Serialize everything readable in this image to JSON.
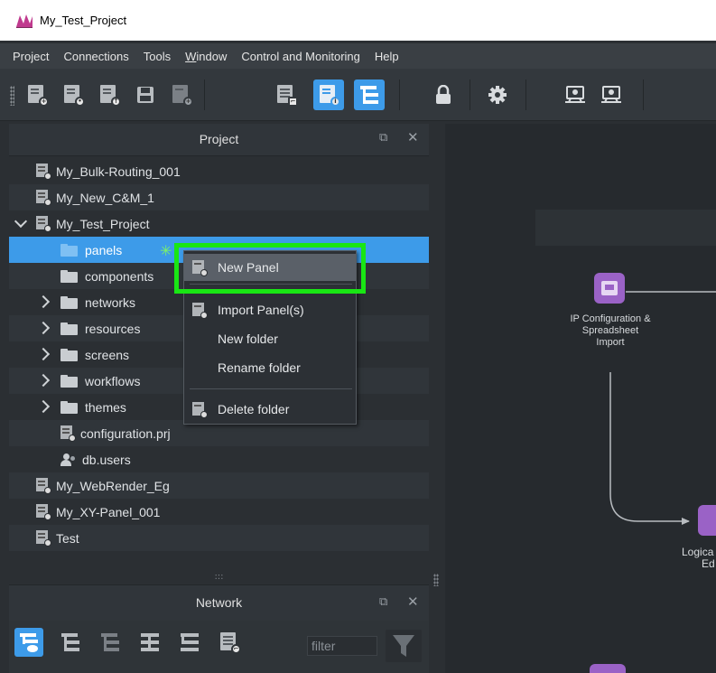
{
  "window": {
    "title": "My_Test_Project"
  },
  "menubar": [
    "Project",
    "Connections",
    "Tools",
    "Window",
    "Control and Monitoring",
    "Help"
  ],
  "toolbar": {
    "buttons": [
      "new-project-icon",
      "import-project-icon",
      "upload-project-icon",
      "save-icon",
      "save-all-icon",
      "diagnostics-icon",
      "project-info-icon",
      "network-tree-icon",
      "lock-icon",
      "settings-icon",
      "monitor-connect-icon",
      "monitor-network-icon"
    ],
    "accent": "#3d9be9"
  },
  "project_panel": {
    "title": "Project",
    "items": [
      {
        "label": "My_Bulk-Routing_001"
      },
      {
        "label": "My_New_C&M_1"
      },
      {
        "label": "My_Test_Project"
      },
      {
        "label": "panels"
      },
      {
        "label": "components"
      },
      {
        "label": "networks"
      },
      {
        "label": "resources"
      },
      {
        "label": "screens"
      },
      {
        "label": "workflows"
      },
      {
        "label": "themes"
      },
      {
        "label": "configuration.prj"
      },
      {
        "label": "db.users"
      },
      {
        "label": "My_WebRender_Eg"
      },
      {
        "label": "My_XY-Panel_001"
      },
      {
        "label": "Test"
      }
    ],
    "splitter_grip": ":::"
  },
  "context_menu": {
    "items": [
      "New Panel",
      "Import Panel(s)",
      "New folder",
      "Rename folder",
      "Delete folder"
    ],
    "highlight_color": "#19e614"
  },
  "network_panel": {
    "title": "Network",
    "filter_placeholder": "filter"
  },
  "canvas": {
    "node1_label": "IP Configuration & Spreadsheet Import",
    "node1_lines": [
      "IP Configuration &",
      "Spreadsheet",
      "Import"
    ],
    "node2_lines": [
      "Logica",
      "Ed"
    ]
  }
}
